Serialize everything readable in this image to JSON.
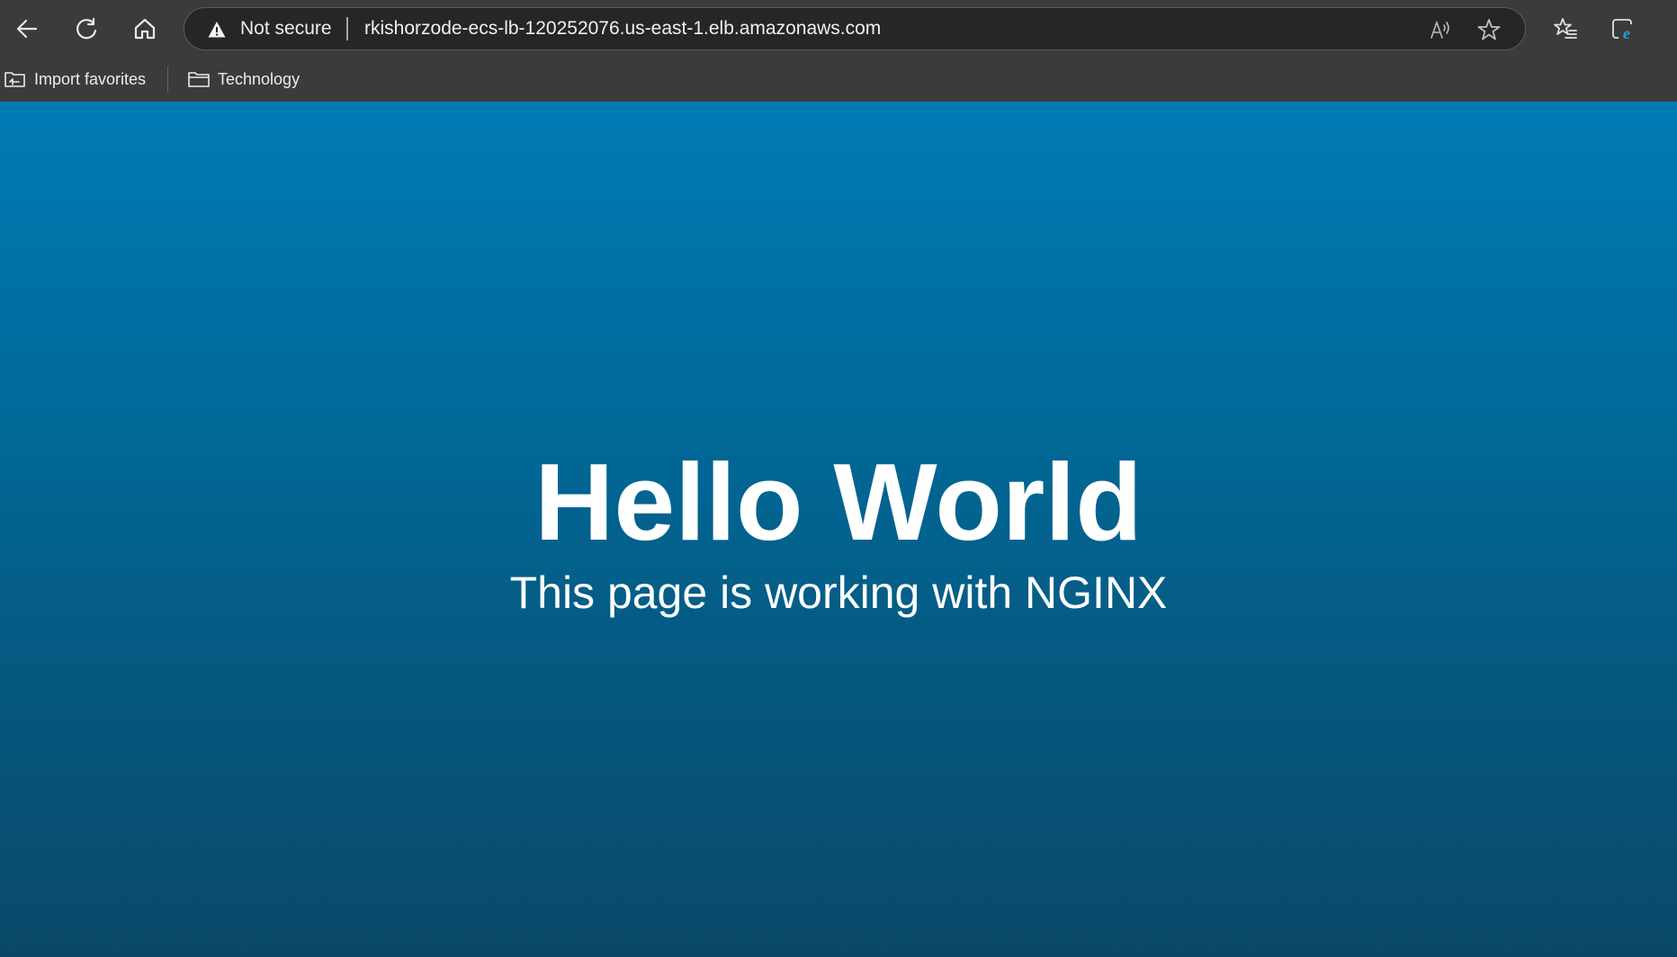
{
  "browser": {
    "address_bar": {
      "security_label": "Not secure",
      "url": "rkishorzode-ecs-lb-120252076.us-east-1.elb.amazonaws.com"
    },
    "bookmarks": [
      {
        "label": "Import favorites",
        "icon": "import-favorites-icon"
      },
      {
        "label": "Technology",
        "icon": "folder-icon"
      }
    ],
    "icons": {
      "nav": [
        "back-arrow-icon",
        "refresh-icon",
        "home-icon"
      ],
      "address": [
        "warning-icon",
        "read-aloud-icon",
        "favorite-star-icon"
      ],
      "toolbar": [
        "favorites-list-icon",
        "internet-explorer-mode-icon"
      ]
    },
    "colors": {
      "chrome_background": "#3b3b3b",
      "address_bar_background": "#262626",
      "ie_icon_accent": "#1ea0f0"
    }
  },
  "page": {
    "title": "Hello World",
    "subtitle": "This page is working with NGINX",
    "colors": {
      "gradient_top": "#007bb4",
      "gradient_bottom": "#0a4868",
      "text": "#ffffff"
    }
  }
}
